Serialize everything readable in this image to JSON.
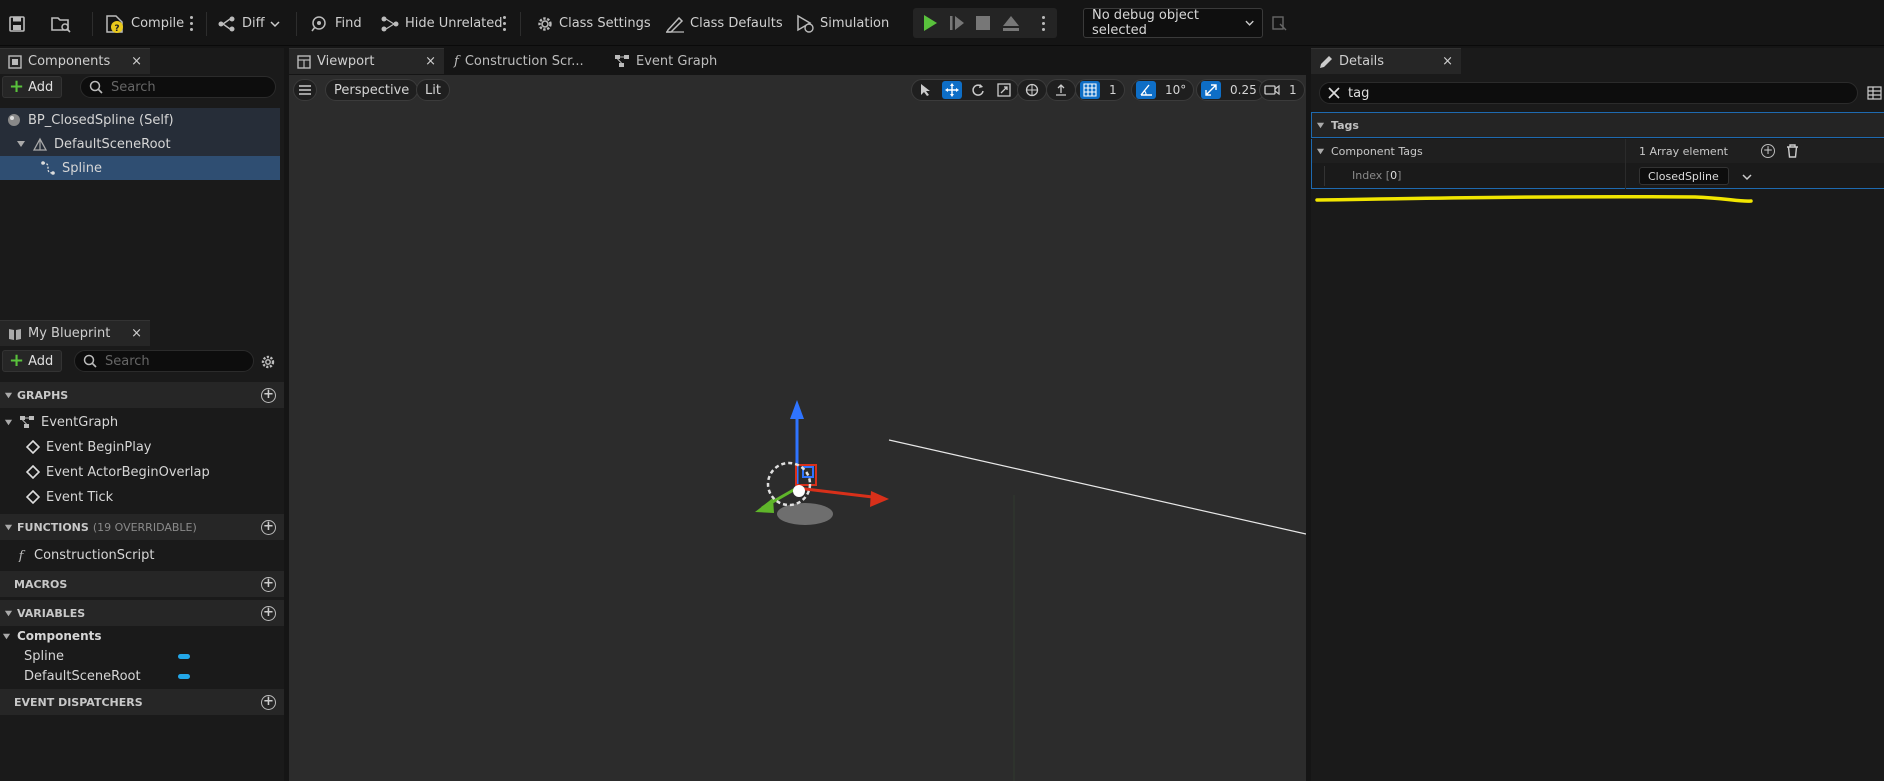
{
  "toolbar": {
    "compile_label": "Compile",
    "diff_label": "Diff",
    "find_label": "Find",
    "hide_unrelated_label": "Hide Unrelated",
    "class_settings_label": "Class Settings",
    "class_defaults_label": "Class Defaults",
    "simulation_label": "Simulation",
    "debug_select_value": "No debug object selected"
  },
  "components_panel": {
    "tab_label": "Components",
    "close_label": "×",
    "add_label": "Add",
    "search_placeholder": "Search",
    "tree": [
      {
        "label": "BP_ClosedSpline (Self)"
      },
      {
        "label": "DefaultSceneRoot"
      },
      {
        "label": "Spline"
      }
    ]
  },
  "my_blueprint": {
    "tab_label": "My Blueprint",
    "close_label": "×",
    "add_label": "Add",
    "search_placeholder": "Search",
    "graphs_header": "GRAPHS",
    "graphs": [
      {
        "label": "EventGraph"
      },
      {
        "label": "Event BeginPlay"
      },
      {
        "label": "Event ActorBeginOverlap"
      },
      {
        "label": "Event Tick"
      }
    ],
    "functions_header": "FUNCTIONS",
    "functions_count": "(19 OVERRIDABLE)",
    "functions": [
      {
        "label": "ConstructionScript"
      }
    ],
    "macros_header": "MACROS",
    "variables_header": "VARIABLES",
    "variables_category": "Components",
    "variables": [
      {
        "label": "Spline"
      },
      {
        "label": "DefaultSceneRoot"
      }
    ],
    "dispatchers_header": "EVENT DISPATCHERS"
  },
  "editor_tabs": [
    {
      "label": "Viewport",
      "close": "×"
    },
    {
      "label": "Construction Scr..."
    },
    {
      "label": "Event Graph"
    }
  ],
  "viewport": {
    "perspective_label": "Perspective",
    "lit_label": "Lit",
    "grid_snap": "1",
    "rotation_snap": "10°",
    "scale_snap": "0.25",
    "camera_speed": "1"
  },
  "details": {
    "tab_label": "Details",
    "close_label": "×",
    "search_value": "tag",
    "category": "Tags",
    "property_name": "Component Tags",
    "array_summary": "1 Array element",
    "index_label_prefix": "Index [",
    "index_value": "0",
    "index_label_suffix": "]",
    "element_value": "ClosedSpline"
  },
  "colors": {
    "accent_blue": "#0e6ec6",
    "highlight_annotation": "#f2e600",
    "play_green": "#59c13c"
  }
}
